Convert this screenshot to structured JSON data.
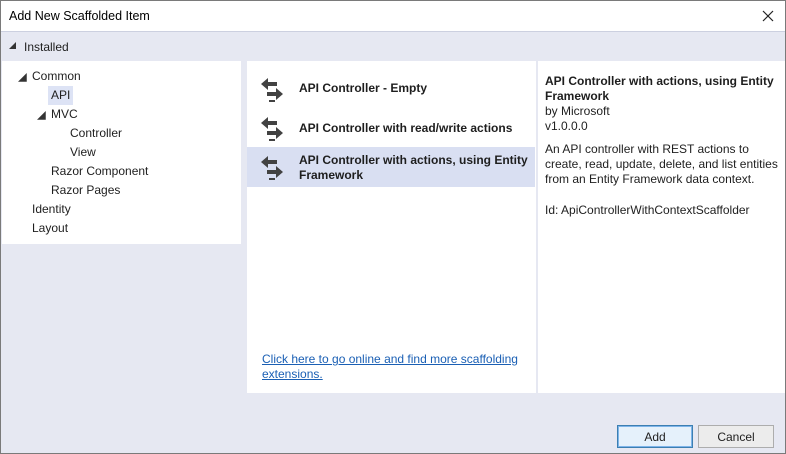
{
  "window": {
    "title": "Add New Scaffolded Item"
  },
  "installed": {
    "label": "Installed"
  },
  "tree": {
    "common": "Common",
    "api": "API",
    "mvc": "MVC",
    "controller": "Controller",
    "view": "View",
    "razor_component": "Razor Component",
    "razor_pages": "Razor Pages",
    "identity": "Identity",
    "layout": "Layout"
  },
  "scaffolders": [
    {
      "label": "API Controller - Empty"
    },
    {
      "label": "API Controller with read/write actions"
    },
    {
      "label_line1": "API Controller with actions, using Entity",
      "label_line2": "Framework"
    }
  ],
  "online_link": {
    "line1": "Click here to go online and find more scaffolding",
    "line2": "extensions."
  },
  "details": {
    "title_line1": "API Controller with actions, using Entity",
    "title_line2": "Framework",
    "author": "by Microsoft",
    "version": "v1.0.0.0",
    "desc_line1": "An API controller with REST actions to",
    "desc_line2": "create, read, update, delete, and list entities",
    "desc_line3": "from an Entity Framework data context.",
    "id": "Id: ApiControllerWithContextScaffolder"
  },
  "buttons": {
    "add": "Add",
    "cancel": "Cancel"
  },
  "colors": {
    "panel_bg": "#e6e8f2",
    "selection": "#d9dff2",
    "link": "#1a5fb4"
  },
  "icons": {
    "close": "close-icon",
    "expanded": "expanded-triangle-icon",
    "scaffolder": "api-controller-icon"
  }
}
